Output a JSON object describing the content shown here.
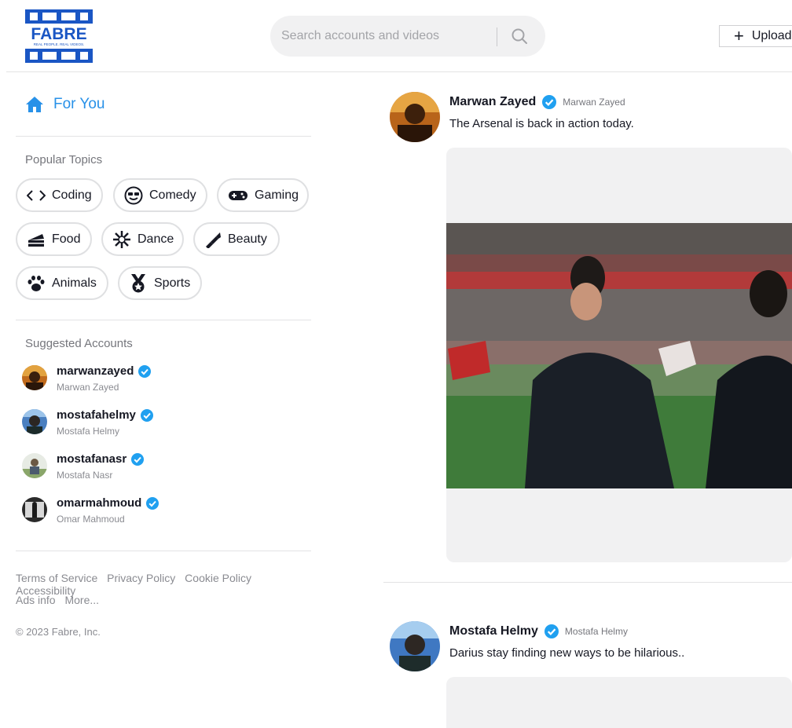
{
  "brand": {
    "name": "FABRE",
    "tagline": "REAL PEOPLE. REAL VIDEOS.",
    "color": "#1a56c4"
  },
  "search": {
    "placeholder": "Search accounts and videos",
    "icon": "search-icon"
  },
  "header": {
    "upload_label": "Upload"
  },
  "sidebar": {
    "for_you_label": "For You",
    "popular_topics_title": "Popular Topics",
    "topics": [
      {
        "label": "Coding",
        "icon": "code-icon"
      },
      {
        "label": "Comedy",
        "icon": "sunglasses-face-icon"
      },
      {
        "label": "Gaming",
        "icon": "gamepad-icon"
      },
      {
        "label": "Food",
        "icon": "cake-icon"
      },
      {
        "label": "Dance",
        "icon": "disco-icon"
      },
      {
        "label": "Beauty",
        "icon": "lipstick-icon"
      },
      {
        "label": "Animals",
        "icon": "paw-icon"
      },
      {
        "label": "Sports",
        "icon": "medal-icon"
      }
    ],
    "suggested_title": "Suggested Accounts",
    "accounts": [
      {
        "username": "marwanzayed",
        "name": "Marwan Zayed"
      },
      {
        "username": "mostafahelmy",
        "name": "Mostafa Helmy"
      },
      {
        "username": "mostafanasr",
        "name": "Mostafa Nasr"
      },
      {
        "username": "omarmahmoud",
        "name": "Omar Mahmoud"
      }
    ],
    "footer_links_row1": [
      "Terms of Service",
      "Privacy Policy",
      "Cookie Policy",
      "Accessibility"
    ],
    "footer_links_row2": [
      "Ads info",
      "More..."
    ],
    "copyright": "© 2023 Fabre, Inc."
  },
  "feed": {
    "posts": [
      {
        "display_name": "Marwan Zayed",
        "handle": "Marwan Zayed",
        "caption": "The Arsenal is back in action today."
      },
      {
        "display_name": "Mostafa Helmy",
        "handle": "Mostafa Helmy",
        "caption": "Darius stay finding new ways to be hilarious.."
      }
    ]
  },
  "colors": {
    "accent": "#2891e8",
    "verified": "#20a0f0",
    "border": "#dfe0e2",
    "muted_text": "#8a8b91"
  }
}
